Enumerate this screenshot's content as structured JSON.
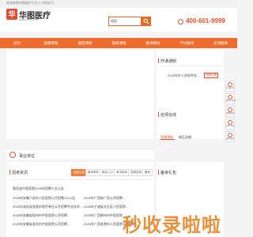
{
  "topbar": {
    "text": "欢迎来到华图医疗卫生人才网学习"
  },
  "header": {
    "logo_badge": "华",
    "logo_name": "华图医疗",
    "logo_url": "www.huatu.com",
    "search_value": "搜索",
    "phone": "400-601-9999"
  },
  "nav": {
    "items": [
      "首页",
      "直播课程",
      "面授课程",
      "题库课程",
      "图书教材",
      "学试报考",
      "在线题库"
    ]
  },
  "notice": {
    "title": "开课通知",
    "item": "2025年护士资格考前...",
    "item_tag": "查看详情"
  },
  "teachers": {
    "title": "名师在线",
    "tabs": [
      "直播课程",
      "精品录播"
    ]
  },
  "unit": {
    "title": "事业单位"
  },
  "news": {
    "title": "招考资讯",
    "tabs": [
      "省级公告",
      "报考条件",
      "报名入口",
      "考试时间",
      "成绩查询",
      "备考"
    ],
    "left_items": [
      "陕西省中医医院2025年招聘人员公告",
      "2025年安徽六安市人民医院公开招聘111公告",
      "2025年湖北省宜昌市医疗单位公开招聘专业技术...",
      "2025年安徽省宿州市中医医院公开招聘...",
      "2025年安徽省淮北市中医医院公开招聘..."
    ],
    "right_items": [
      "2025年广西新广西公开招聘...",
      "2025年宁波省北仑区人民医院...",
      "2025年广西柳州市中医医院...",
      "2025年广西贵港市人民医院公开招聘..."
    ]
  },
  "exam": {
    "title": "备考礼包"
  },
  "sidebar": {
    "tools": [
      "在线咨询",
      "微信公众号",
      "课程咨询",
      "APP下载",
      "返回顶部"
    ]
  },
  "watermark": {
    "text": "秒收录啦啦"
  },
  "colors": {
    "accent": "#ef6c2f",
    "brand_red": "#e34b2f",
    "phone": "#e8502c"
  }
}
